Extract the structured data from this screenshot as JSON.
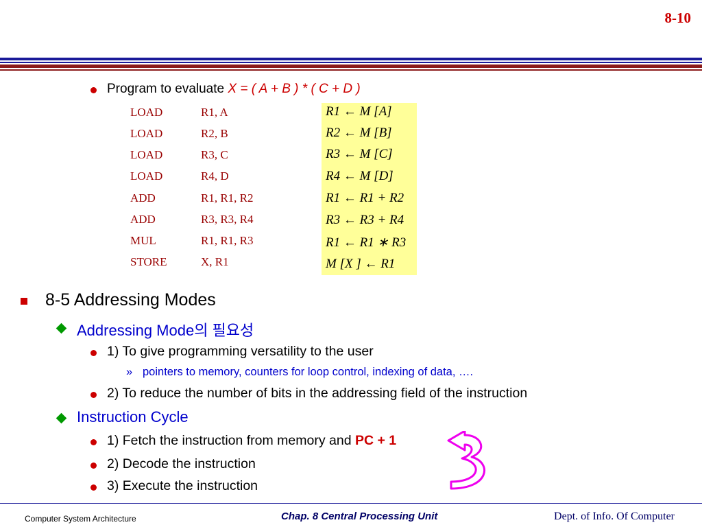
{
  "slide_number": "8-10",
  "program": {
    "intro": "Program to evaluate",
    "expression": "X = ( A + B ) * ( C + D )",
    "code": [
      {
        "op": "LOAD",
        "args": "R1, A"
      },
      {
        "op": "LOAD",
        "args": "R2, B"
      },
      {
        "op": "LOAD",
        "args": "R3, C"
      },
      {
        "op": "LOAD",
        "args": "R4, D"
      },
      {
        "op": "ADD",
        "args": "R1, R1, R2"
      },
      {
        "op": "ADD",
        "args": "R3, R3, R4"
      },
      {
        "op": "MUL",
        "args": "R1, R1, R3"
      },
      {
        "op": "STORE",
        "args": "X, R1"
      }
    ],
    "rtl": [
      "R1 ← M [A]",
      "R2 ← M [B]",
      "R3 ← M [C]",
      "R4 ← M [D]",
      "R1 ← R1 + R2",
      "R3 ← R3 + R4",
      "R1 ← R1 ∗ R3",
      "M [X ] ← R1"
    ]
  },
  "section": {
    "heading": "8-5  Addressing Modes",
    "sub1": {
      "title": "Addressing Mode의 필요성",
      "item1": "1) To give programming versatility to the user",
      "item1_sub": "pointers to memory, counters for loop control, indexing of data, ….",
      "item2": "2) To reduce the number of bits in the addressing field of the instruction"
    },
    "sub2": {
      "title": "Instruction Cycle",
      "item1_prefix": "1) Fetch the instruction from memory and ",
      "item1_highlight": "PC + 1",
      "item2": "2) Decode the instruction",
      "item3": "3) Execute the instruction"
    }
  },
  "footer": {
    "left": "Computer System Architecture",
    "center": "Chap. 8  Central Processing Unit",
    "right": "Dept. of Info. Of Computer"
  },
  "colors": {
    "accent_red": "#cc0000",
    "heading_blue": "#0000cc",
    "code_dark_red": "#990000",
    "rtl_highlight": "#ffff99",
    "arrow_magenta": "#ee00ee"
  },
  "icons": {
    "cycle_arrow": "curved-return-arrow-icon"
  }
}
